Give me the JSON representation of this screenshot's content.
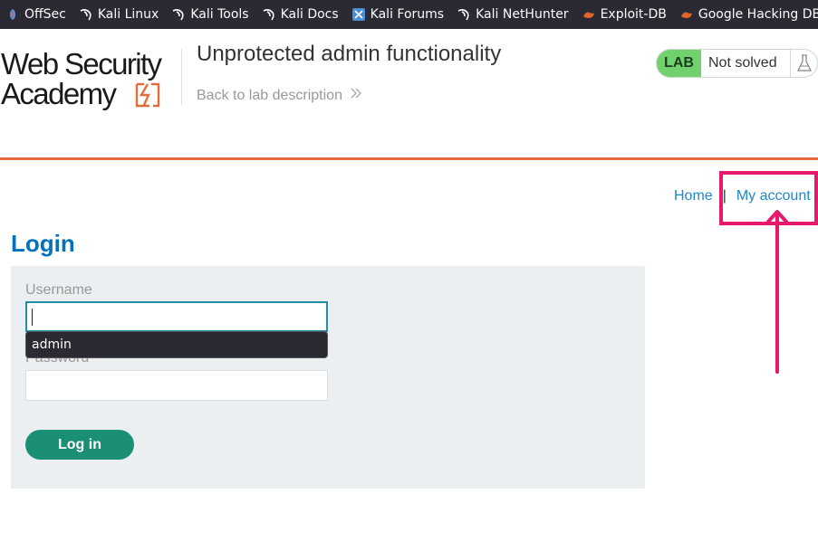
{
  "bookmarks": [
    {
      "label": "OffSec",
      "icon": "offsec-icon"
    },
    {
      "label": "Kali Linux",
      "icon": "kali-dragon-icon"
    },
    {
      "label": "Kali Tools",
      "icon": "kali-dragon-icon"
    },
    {
      "label": "Kali Docs",
      "icon": "kali-dragon-icon"
    },
    {
      "label": "Kali Forums",
      "icon": "kali-forums-icon"
    },
    {
      "label": "Kali NetHunter",
      "icon": "kali-dragon-icon"
    },
    {
      "label": "Exploit-DB",
      "icon": "exploit-db-icon"
    },
    {
      "label": "Google Hacking DB",
      "icon": "exploit-db-icon"
    }
  ],
  "header": {
    "logo_line1": "Web Security",
    "logo_line2": "Academy",
    "lab_title": "Unprotected admin functionality",
    "back_link": "Back to lab description",
    "status_tag": "LAB",
    "status_text": "Not solved",
    "status_icon": "flask-icon"
  },
  "nav": {
    "home": "Home",
    "separator": "|",
    "my_account": "My account"
  },
  "login": {
    "heading": "Login",
    "username_label": "Username",
    "username_value": "",
    "password_label": "Password",
    "password_value": "",
    "autocomplete_suggestion": "admin",
    "button_label": "Log in"
  },
  "colors": {
    "bookmarks_bg": "#2b2a33",
    "accent_orange": "#e16e3a",
    "link_blue": "#1e88c7",
    "heading_blue": "#0071bc",
    "lab_green": "#70d16d",
    "button_green": "#1b8f76",
    "highlight_pink": "#e8186f",
    "panel_bg": "#ebeff2"
  }
}
